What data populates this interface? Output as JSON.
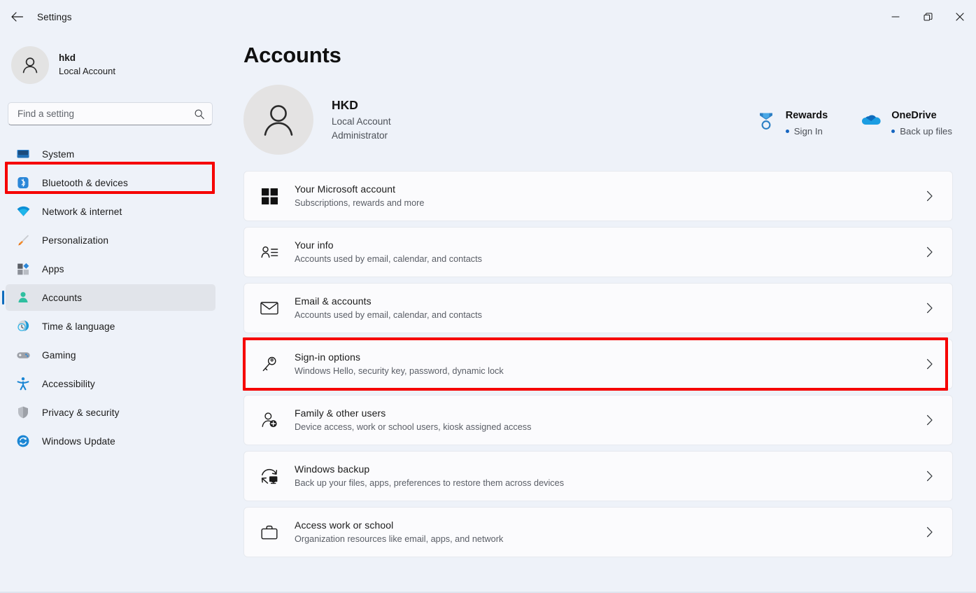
{
  "titlebar": {
    "back_label": "back-arrow",
    "title": "Settings",
    "minimize": "minimize-icon",
    "restore": "restore-icon",
    "close": "close-icon"
  },
  "sidebar": {
    "profile": {
      "name": "hkd",
      "subtitle": "Local Account",
      "avatar_icon": "person-icon"
    },
    "search": {
      "placeholder": "Find a setting",
      "value": "",
      "icon": "search-icon"
    },
    "items": [
      {
        "label": "System",
        "icon": "monitor-icon",
        "selected": false
      },
      {
        "label": "Bluetooth & devices",
        "icon": "bluetooth-icon",
        "selected": false
      },
      {
        "label": "Network & internet",
        "icon": "wifi-icon",
        "selected": false
      },
      {
        "label": "Personalization",
        "icon": "paintbrush-icon",
        "selected": false
      },
      {
        "label": "Apps",
        "icon": "apps-icon",
        "selected": false
      },
      {
        "label": "Accounts",
        "icon": "person-badge-icon",
        "selected": true
      },
      {
        "label": "Time & language",
        "icon": "clock-globe-icon",
        "selected": false
      },
      {
        "label": "Gaming",
        "icon": "gamepad-icon",
        "selected": false
      },
      {
        "label": "Accessibility",
        "icon": "accessibility-icon",
        "selected": false
      },
      {
        "label": "Privacy & security",
        "icon": "shield-icon",
        "selected": false
      },
      {
        "label": "Windows Update",
        "icon": "update-icon",
        "selected": false
      }
    ]
  },
  "main": {
    "page_title": "Accounts",
    "account": {
      "avatar_icon": "person-icon",
      "name": "HKD",
      "type": "Local Account",
      "role": "Administrator"
    },
    "widgets": [
      {
        "title": "Rewards",
        "status": "Sign In",
        "icon": "medal-icon"
      },
      {
        "title": "OneDrive",
        "status": "Back up files",
        "icon": "cloud-icon"
      }
    ],
    "cards": [
      {
        "title": "Your Microsoft account",
        "subtitle": "Subscriptions, rewards and more",
        "icon": "microsoft-logo-icon",
        "highlighted": false
      },
      {
        "title": "Your info",
        "subtitle": "Accounts used by email, calendar, and contacts",
        "icon": "contact-info-icon",
        "highlighted": false
      },
      {
        "title": "Email & accounts",
        "subtitle": "Accounts used by email, calendar, and contacts",
        "icon": "envelope-icon",
        "highlighted": false
      },
      {
        "title": "Sign-in options",
        "subtitle": "Windows Hello, security key, password, dynamic lock",
        "icon": "key-icon",
        "highlighted": true
      },
      {
        "title": "Family & other users",
        "subtitle": "Device access, work or school users, kiosk assigned access",
        "icon": "person-add-icon",
        "highlighted": false
      },
      {
        "title": "Windows backup",
        "subtitle": "Back up your files, apps, preferences to restore them across devices",
        "icon": "backup-icon",
        "highlighted": false
      },
      {
        "title": "Access work or school",
        "subtitle": "Organization resources like email, apps, and network",
        "icon": "briefcase-icon",
        "highlighted": false
      }
    ],
    "chevron_icon": "chevron-right-icon"
  },
  "annotations": {
    "highlight_color": "#f60000",
    "accent_color": "#0f6cbd"
  }
}
